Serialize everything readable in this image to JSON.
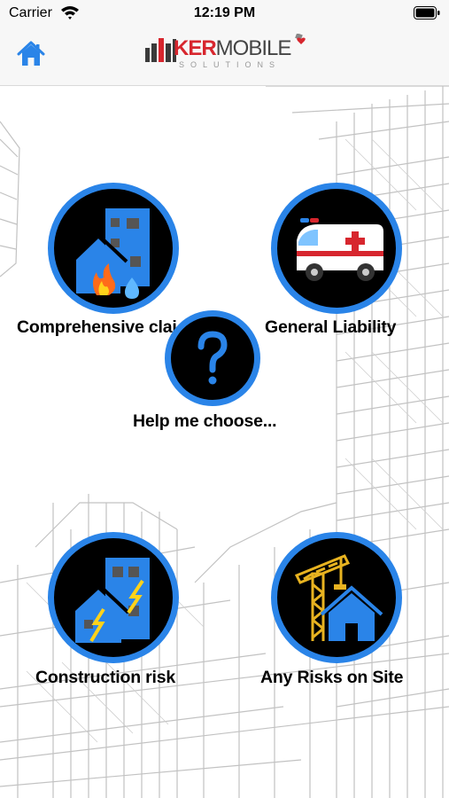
{
  "status_bar": {
    "carrier": "Carrier",
    "time": "12:19 PM"
  },
  "header": {
    "home_icon": "home-icon",
    "logo": {
      "word_red": "KER",
      "word_gray": "MOBILE",
      "tagline": "SOLUTIONS"
    }
  },
  "tiles": [
    {
      "label": "Comprehensive clai",
      "icon": "buildings-fire-water-icon"
    },
    {
      "label": "General Liability",
      "icon": "ambulance-icon"
    },
    {
      "label": "Help me choose...",
      "icon": "question-mark-icon"
    },
    {
      "label": "Construction risk",
      "icon": "buildings-lightning-icon"
    },
    {
      "label": "Any Risks on Site",
      "icon": "crane-house-icon"
    }
  ],
  "colors": {
    "accent_blue": "#2a84e8",
    "circle_bg": "#000000",
    "brand_red": "#d7262e"
  }
}
